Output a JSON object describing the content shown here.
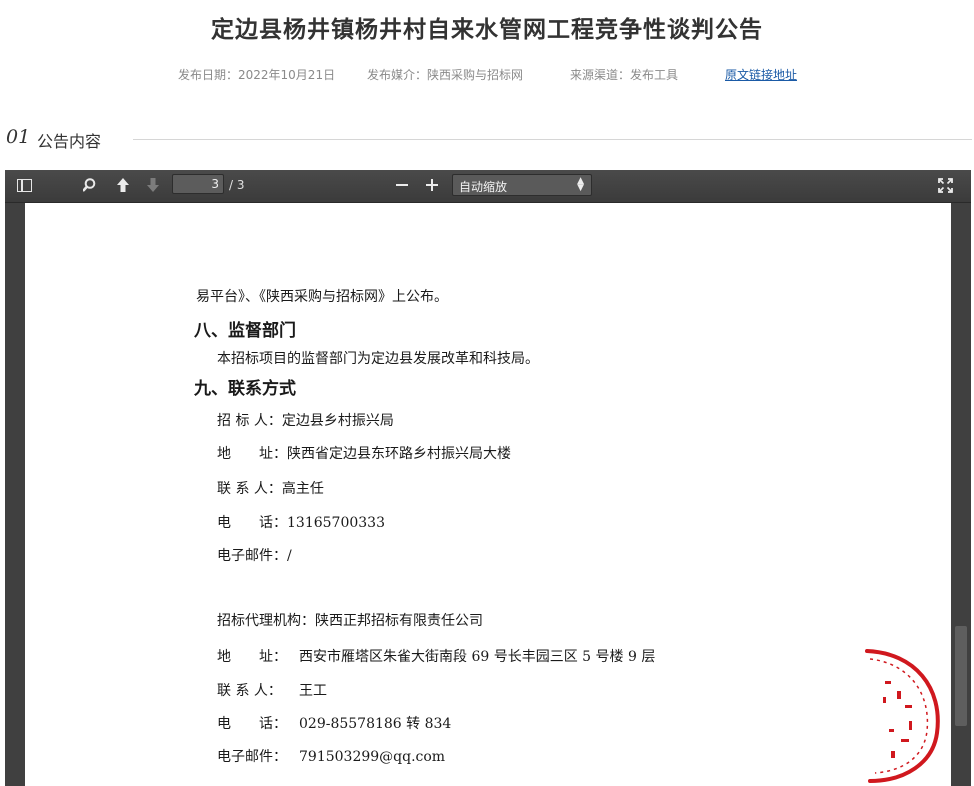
{
  "title": "定边县杨井镇杨井村自来水管网工程竞争性谈判公告",
  "meta": {
    "date": "发布日期：2022年10月21日",
    "media": "发布媒介：陕西采购与招标网",
    "source": "来源渠道：发布工具",
    "link": "原文链接地址"
  },
  "section": {
    "number": "01",
    "label": "公告内容"
  },
  "viewer": {
    "toolbar": {
      "page_current": "3",
      "page_total": "/ 3",
      "zoom": "自动缩放",
      "icons": [
        "sidebar-toggle-icon",
        "search-icon",
        "previous-page-icon",
        "next-page-icon",
        "zoom-out-icon",
        "zoom-in-icon",
        "fullscreen-icon"
      ]
    },
    "page": {
      "line1": "易平台》、《陕西采购与招标网》上公布。",
      "h8": "八、监督部门",
      "supervise": "本招标项目的监督部门为定边县发展改革和科技局。",
      "h9": "九、联系方式",
      "tenderer": {
        "label": "招 标 人：",
        "value": "定边县乡村振兴局"
      },
      "address1": {
        "label": "地　　址：",
        "value": "陕西省定边县东环路乡村振兴局大楼"
      },
      "contact1": {
        "label": "联 系 人：",
        "value": "高主任"
      },
      "phone1": {
        "label": "电　　话：",
        "value": "13165700333"
      },
      "email1": {
        "label": "电子邮件：",
        "value": "/"
      },
      "agency": {
        "label": "招标代理机构：",
        "value": "陕西正邦招标有限责任公司"
      },
      "address2": {
        "label": "地　　址：",
        "value": "西安市雁塔区朱雀大街南段 69 号长丰园三区 5 号楼 9 层"
      },
      "contact2": {
        "label": "联 系 人：",
        "value": "王工"
      },
      "phone2": {
        "label": "电　　话：",
        "value": "029-85578186 转 834"
      },
      "email2": {
        "label": "电子邮件：",
        "value": "791503299@qq.com"
      }
    },
    "seal_color": "#d0181e"
  }
}
